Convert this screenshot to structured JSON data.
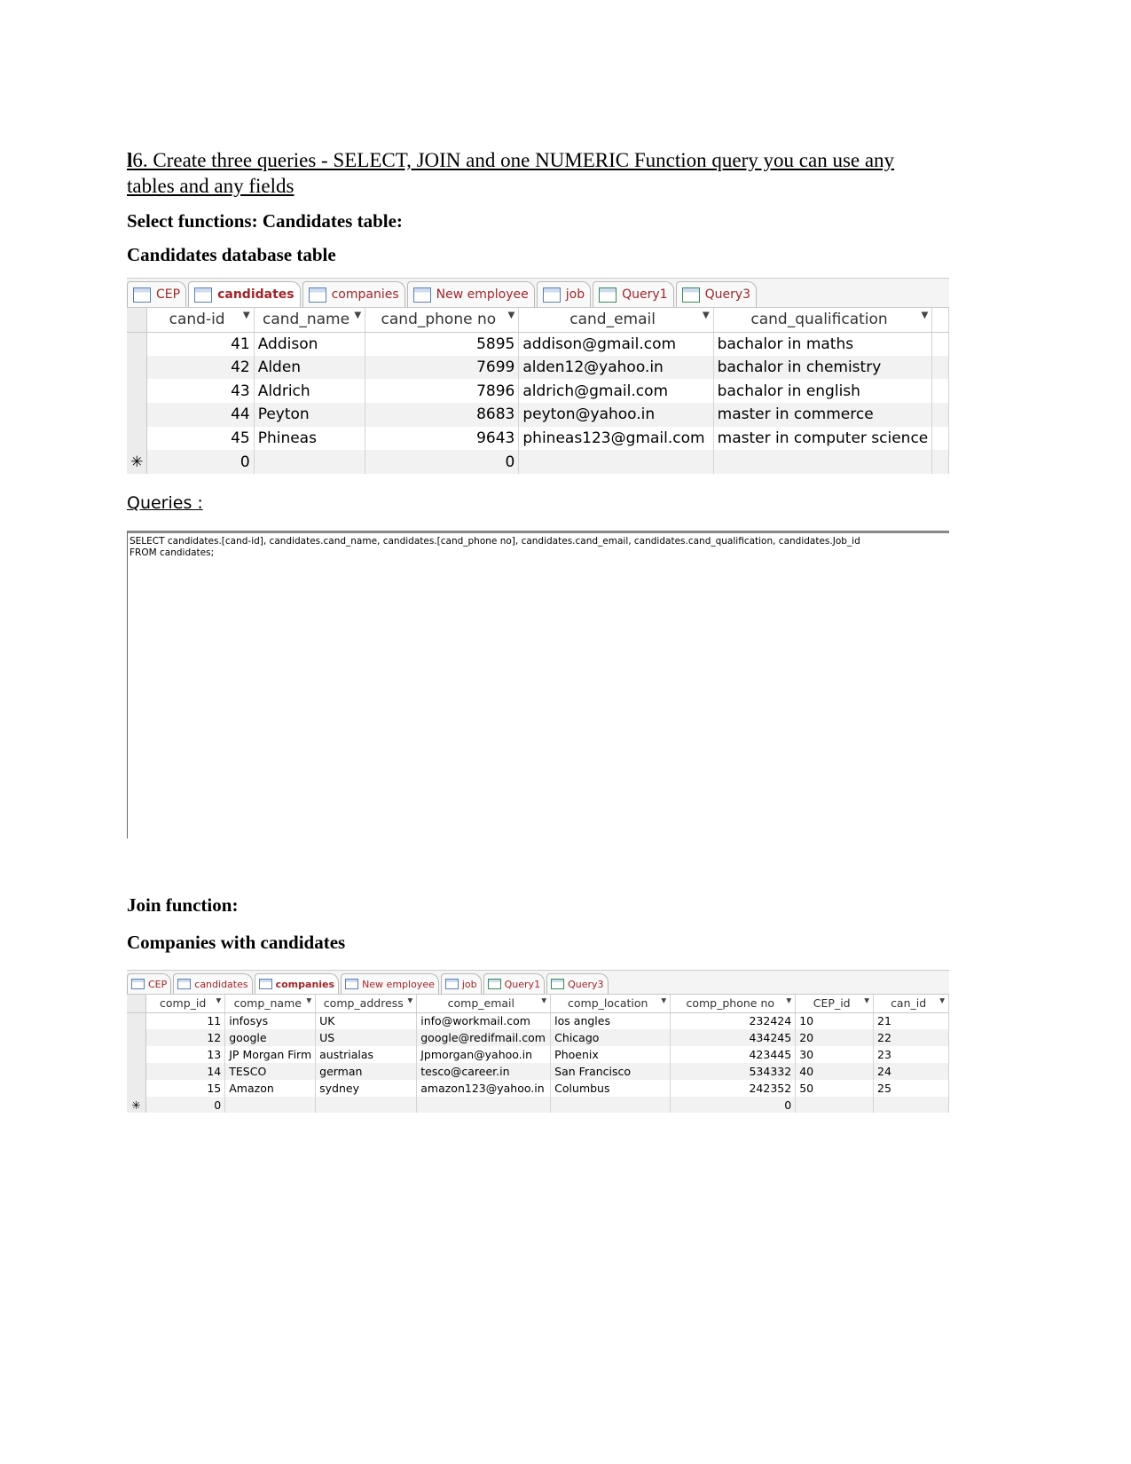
{
  "heading": {
    "prefix": "l",
    "text": "6. Create three queries - SELECT, JOIN and one NUMERIC Function query you can use any tables and any fields"
  },
  "select_heading": "Select functions: Candidates table:",
  "candidates_heading": "Candidates database table",
  "queries_label": "Queries :",
  "query_sql": "SELECT candidates.[cand-id], candidates.cand_name, candidates.[cand_phone no], candidates.cand_email, candidates.cand_qualification, candidates.Job_id\nFROM candidates;",
  "join_heading": "Join function:",
  "companies_heading": "Companies with candidates",
  "accent_color": "#a0262a",
  "tabs": [
    {
      "label": "CEP",
      "icon": "table-icon"
    },
    {
      "label": "candidates",
      "icon": "table-icon"
    },
    {
      "label": "companies",
      "icon": "table-icon"
    },
    {
      "label": "New employee",
      "icon": "table-icon"
    },
    {
      "label": "job",
      "icon": "table-icon"
    },
    {
      "label": "Query1",
      "icon": "query-icon"
    },
    {
      "label": "Query3",
      "icon": "query-icon"
    }
  ],
  "candidates_table": {
    "active_tab": 1,
    "columns": [
      "cand-id",
      "cand_name",
      "cand_phone no",
      "cand_email",
      "cand_qualification"
    ],
    "rows": [
      [
        "41",
        "Addison",
        "5895",
        "addison@gmail.com",
        "bachalor in maths"
      ],
      [
        "42",
        "Alden",
        "7699",
        "alden12@yahoo.in",
        "bachalor in chemistry"
      ],
      [
        "43",
        "Aldrich",
        "7896",
        "aldrich@gmail.com",
        "bachalor in english"
      ],
      [
        "44",
        "Peyton",
        "8683",
        "peyton@yahoo.in",
        "master in commerce"
      ],
      [
        "45",
        "Phineas",
        "9643",
        "phineas123@gmail.com",
        "master in computer science"
      ]
    ],
    "new_row": [
      "0",
      "",
      "0",
      "",
      ""
    ],
    "new_row_marker": "✳"
  },
  "companies_table": {
    "active_tab": 2,
    "columns": [
      "comp_id",
      "comp_name",
      "comp_address",
      "comp_email",
      "comp_location",
      "comp_phone no",
      "CEP_id",
      "can_id"
    ],
    "rows": [
      [
        "11",
        "infosys",
        "UK",
        "info@workmail.com",
        "los angles",
        "232424",
        "10",
        "21"
      ],
      [
        "12",
        "google",
        "US",
        "google@redifmail.com",
        "Chicago",
        "434245",
        "20",
        "22"
      ],
      [
        "13",
        "JP Morgan Firm",
        "austrialas",
        "Jpmorgan@yahoo.in",
        "Phoenix",
        "423445",
        "30",
        "23"
      ],
      [
        "14",
        "TESCO",
        "german",
        "tesco@career.in",
        "San Francisco",
        "534332",
        "40",
        "24"
      ],
      [
        "15",
        "Amazon",
        "sydney",
        "amazon123@yahoo.in",
        "Columbus",
        "242352",
        "50",
        "25"
      ]
    ],
    "new_row": [
      "0",
      "",
      "",
      "",
      "",
      "0",
      "",
      ""
    ],
    "new_row_marker": "✳"
  }
}
